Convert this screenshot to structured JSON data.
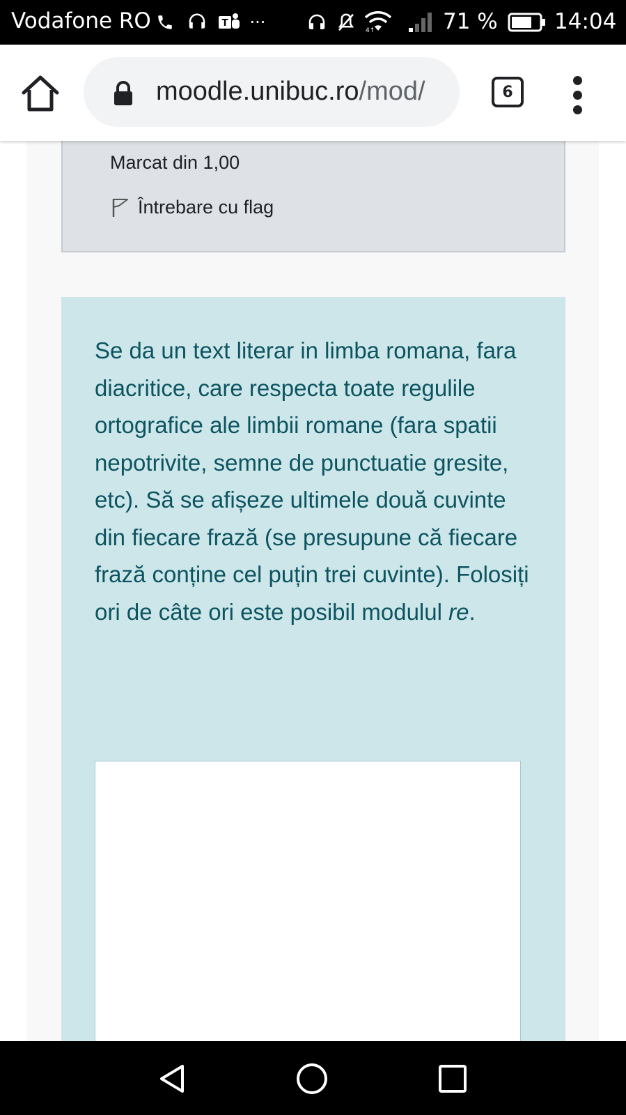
{
  "status_bar": {
    "carrier": "Vodafone RO",
    "battery_percent": "71 %",
    "battery_level": 0.71,
    "time": "14:04",
    "overflow": "···",
    "icons": [
      "phone-icon",
      "headset-icon",
      "teams-icon",
      "overflow-dots-icon",
      "headphones-icon",
      "muted-icon",
      "wifi-icon",
      "signal-icon",
      "battery-icon"
    ]
  },
  "browser": {
    "url_host": "moodle.unibuc.ro",
    "url_path": "/mod/",
    "tab_count": "6",
    "icons": [
      "home-icon",
      "lock-icon",
      "tab-switcher-icon",
      "more-vert-icon"
    ]
  },
  "question_info": {
    "mark": "Marcat din 1,00",
    "flag_label": "Întrebare cu flag"
  },
  "question": {
    "text_main": "Se da un text literar in limba romana, fara diacritice, care respecta toate regulile ortografice ale limbii romane (fara spatii nepotrivite, semne de punctuatie gresite, etc). Să se afișeze ultimele două cuvinte din fiecare frază (se presupune că fiecare frază conține cel puțin trei cuvinte). Folosiți ori de câte ori este posibil modulul ",
    "text_em": "re",
    "text_end": ".",
    "answer_value": ""
  },
  "colors": {
    "info_bg": "#dee2e6",
    "question_bg": "#cde6ea",
    "question_text": "#0c5460",
    "page_bg": "#f8f8f8"
  },
  "nav_bar": {
    "icons": [
      "back-triangle-icon",
      "home-circle-icon",
      "recents-square-icon"
    ]
  }
}
